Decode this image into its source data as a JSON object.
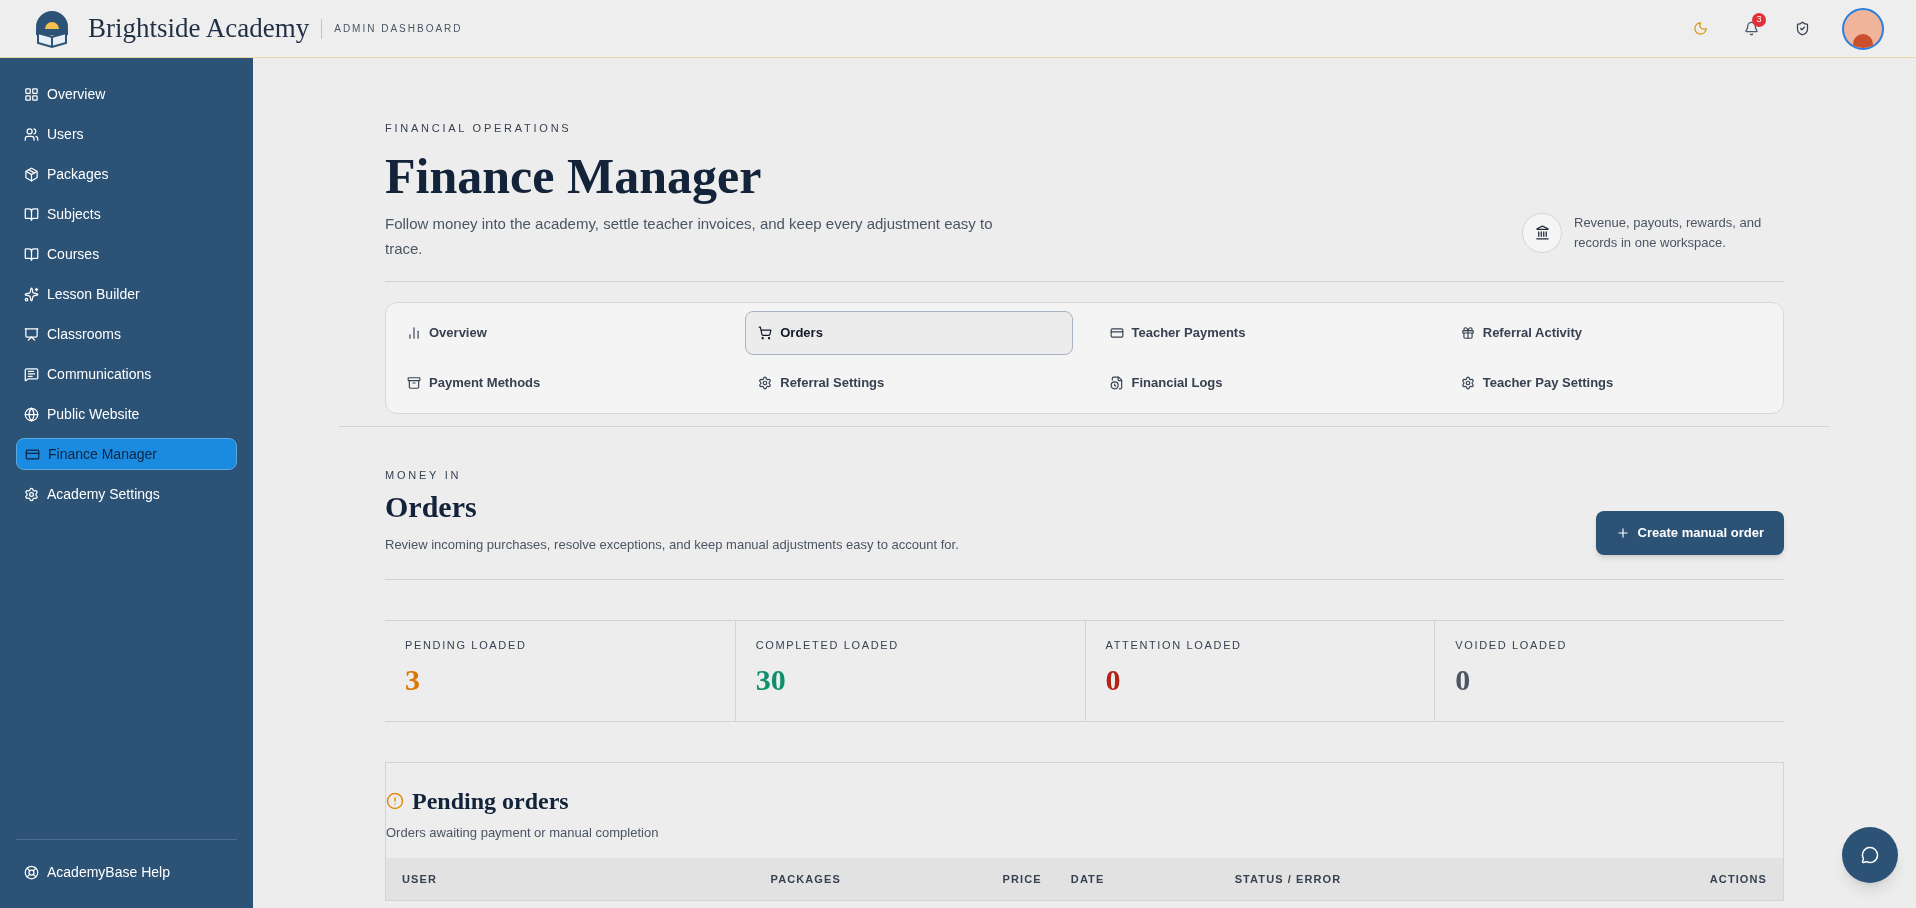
{
  "header": {
    "brand": "Brightside Academy",
    "subtitle": "ADMIN DASHBOARD",
    "notification_count": "3"
  },
  "sidebar": {
    "items": [
      {
        "label": "Overview",
        "selected": false
      },
      {
        "label": "Users",
        "selected": false
      },
      {
        "label": "Packages",
        "selected": false
      },
      {
        "label": "Subjects",
        "selected": false
      },
      {
        "label": "Courses",
        "selected": false
      },
      {
        "label": "Lesson Builder",
        "selected": false
      },
      {
        "label": "Classrooms",
        "selected": false
      },
      {
        "label": "Communications",
        "selected": false
      },
      {
        "label": "Public Website",
        "selected": false
      },
      {
        "label": "Finance Manager",
        "selected": true
      },
      {
        "label": "Academy Settings",
        "selected": false
      }
    ],
    "footer": "AcademyBase Help"
  },
  "page": {
    "eyebrow": "FINANCIAL OPERATIONS",
    "title": "Finance Manager",
    "description": "Follow money into the academy, settle teacher invoices, and keep every adjustment easy to trace.",
    "aside": "Revenue, payouts, rewards, and records in one workspace."
  },
  "tabs": [
    {
      "label": "Overview",
      "selected": false
    },
    {
      "label": "Orders",
      "selected": true
    },
    {
      "label": "Teacher Payments",
      "selected": false
    },
    {
      "label": "Referral Activity",
      "selected": false
    },
    {
      "label": "Payment Methods",
      "selected": false
    },
    {
      "label": "Referral Settings",
      "selected": false
    },
    {
      "label": "Financial Logs",
      "selected": false
    },
    {
      "label": "Teacher Pay Settings",
      "selected": false
    }
  ],
  "section": {
    "eyebrow": "MONEY IN",
    "title": "Orders",
    "description": "Review incoming purchases, resolve exceptions, and keep manual adjustments easy to account for.",
    "button": "Create manual order"
  },
  "stats": [
    {
      "label": "PENDING LOADED",
      "value": "3",
      "color": "#d97706"
    },
    {
      "label": "COMPLETED LOADED",
      "value": "30",
      "color": "#0f8f6b"
    },
    {
      "label": "ATTENTION LOADED",
      "value": "0",
      "color": "#b42318"
    },
    {
      "label": "VOIDED LOADED",
      "value": "0",
      "color": "#4b5563"
    }
  ],
  "pending": {
    "title": "Pending orders",
    "description": "Orders awaiting payment or manual completion",
    "columns": [
      "USER",
      "PACKAGES",
      "PRICE",
      "DATE",
      "STATUS / ERROR",
      "ACTIONS"
    ]
  }
}
